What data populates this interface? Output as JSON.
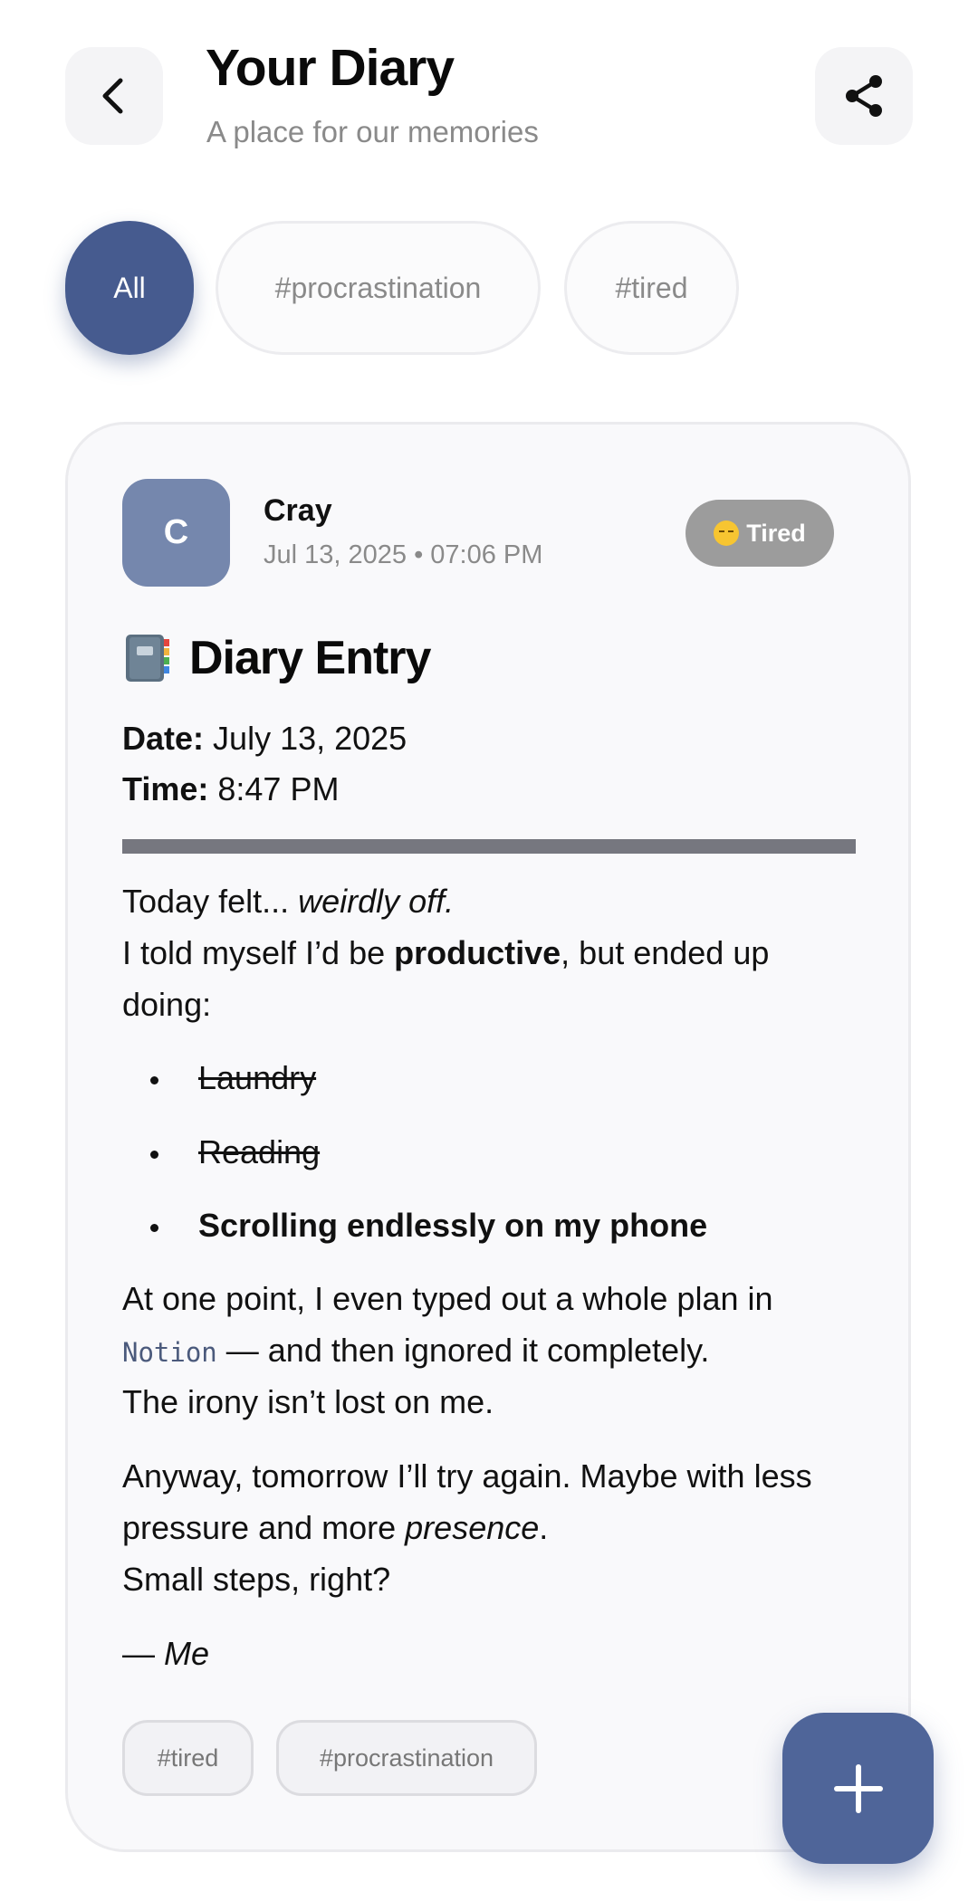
{
  "header": {
    "title": "Your Diary",
    "subtitle": "A place for our memories",
    "back_icon": "chevron-left-icon",
    "share_icon": "share-icon"
  },
  "filters": [
    {
      "label": "All",
      "selected": true
    },
    {
      "label": "#procrastination",
      "selected": false
    },
    {
      "label": "#tired",
      "selected": false
    }
  ],
  "entry": {
    "avatar_initial": "C",
    "author": "Cray",
    "datetime": "Jul 13, 2025 • 07:06 PM",
    "mood_label": "Tired",
    "mood_icon": "sleeping-face-emoji-icon",
    "title_icon": "notebook-icon",
    "title": "Diary Entry",
    "date_label": "Date:",
    "date_value": "July 13, 2025",
    "time_label": "Time:",
    "time_value": "8:47 PM",
    "p1_a": "Today felt... ",
    "p1_b": "weirdly off",
    "p1_c": ".",
    "p2_a": "I told myself I’d be ",
    "p2_b": "productive",
    "p2_c": ", but ended up",
    "p2_d": "doing:",
    "list": [
      "Laundry",
      "Reading",
      "Scrolling endlessly on my phone"
    ],
    "p3_a": "At one point, I even typed out a whole plan in",
    "p3_code": "Notion",
    "p3_b": " — and then ignored it completely.",
    "p3_c": "The irony isn’t lost on me.",
    "p4_a": "Anyway, tomorrow I’ll try again. Maybe with less",
    "p4_b": "pressure and more ",
    "p4_c": "presence",
    "p4_d": ".",
    "p4_e": "Small steps, right?",
    "sign_dash": "— ",
    "sign_name": "Me",
    "tags": [
      "#tired",
      "#procrastination"
    ]
  },
  "fab": {
    "icon": "plus-icon"
  },
  "colors": {
    "accent": "#465b8f",
    "fab": "#4f6599",
    "mood_badge": "#9c9c9c",
    "avatar": "#7587ad"
  }
}
